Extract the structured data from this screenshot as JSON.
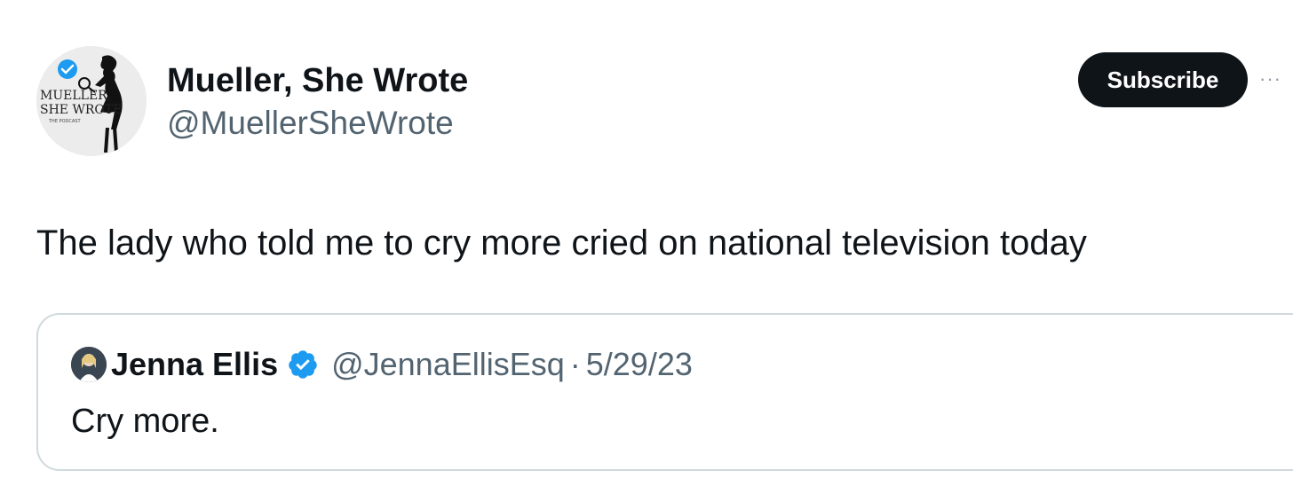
{
  "author": {
    "name": "Mueller, She Wrote",
    "handle": "@MuellerSheWrote",
    "avatar_icon": "podcast-logo-detective-silhouette",
    "avatar_lines": [
      "MUELLER,",
      "SHE WROTE",
      "THE PODCAST"
    ]
  },
  "actions": {
    "subscribe_label": "Subscribe",
    "more_label": "···"
  },
  "tweet": {
    "text": "The lady who told me to cry more cried on national television today"
  },
  "quoted_tweet": {
    "author_name": "Jenna Ellis",
    "verified_icon": "verified-badge-icon",
    "handle": "@JennaEllisEsq",
    "separator": "·",
    "date": "5/29/23",
    "text": "Cry more."
  },
  "colors": {
    "text_primary": "#0f1419",
    "text_secondary": "#536471",
    "verified_blue": "#1d9bf0",
    "button_bg": "#0f1419",
    "border": "#cfd9de"
  }
}
